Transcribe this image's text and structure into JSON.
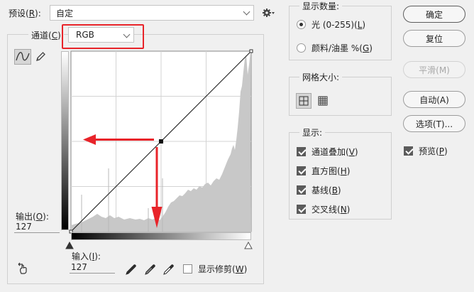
{
  "preset": {
    "label": "预设(",
    "key": "R",
    "tail": "):",
    "value": "自定"
  },
  "channel": {
    "label": "通道(",
    "key": "C",
    "tail": ")",
    "value": "RGB"
  },
  "output": {
    "label": "输出(",
    "key": "O",
    "tail": "):",
    "value": "127"
  },
  "input": {
    "label": "输入(",
    "key": "I",
    "tail": "):",
    "value": "127"
  },
  "show_clipping": {
    "label": "显示修剪(",
    "key": "W",
    "tail": ")",
    "checked": false
  },
  "show_amount": {
    "title": "显示数量:",
    "options": [
      {
        "label": "光 (0-255)(",
        "key": "L",
        "tail": ")",
        "selected": true
      },
      {
        "label": "颜料/油墨 %(",
        "key": "G",
        "tail": ")",
        "selected": false
      }
    ]
  },
  "grid_size": {
    "title": "网格大小:",
    "selected": "simple"
  },
  "show": {
    "title": "显示:",
    "options": [
      {
        "label": "通道叠加(",
        "key": "V",
        "tail": ")",
        "checked": true
      },
      {
        "label": "直方图(",
        "key": "H",
        "tail": ")",
        "checked": true
      },
      {
        "label": "基线(",
        "key": "B",
        "tail": ")",
        "checked": true
      },
      {
        "label": "交叉线(",
        "key": "N",
        "tail": ")",
        "checked": true
      }
    ]
  },
  "buttons": {
    "ok": "确定",
    "reset": "复位",
    "smooth": "平滑(M)",
    "auto": "自动(A)",
    "options": "选项(T)...",
    "preview": {
      "label": "预览(",
      "key": "P",
      "tail": ")",
      "checked": true
    }
  },
  "curve": {
    "input": 127,
    "output": 127
  },
  "colors": {
    "annotation_red": "#e8242a",
    "histogram": "#c8c8c8"
  }
}
